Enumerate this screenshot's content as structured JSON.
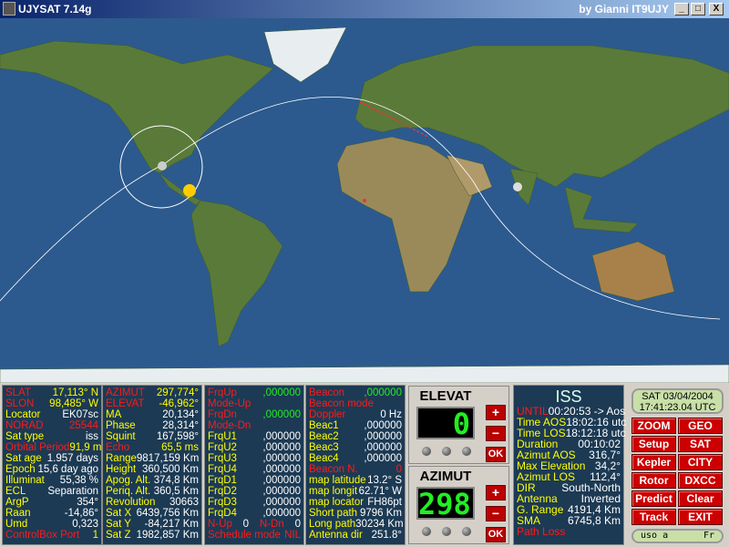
{
  "window": {
    "title": "UJYSAT 7.14g",
    "author": "by Gianni IT9UJY",
    "min": "_",
    "max": "□",
    "close": "X"
  },
  "col1": [
    {
      "label": "SLAT",
      "value": "17,113° N",
      "lc": "r",
      "vc": "y"
    },
    {
      "label": "SLON",
      "value": "98,485° W",
      "lc": "r",
      "vc": "y"
    },
    {
      "label": "Locator",
      "value": "EK07sc",
      "lc": "y",
      "vc": "w"
    },
    {
      "label": "NORAD",
      "value": "25544",
      "lc": "r",
      "vc": "r"
    },
    {
      "label": "Sat type",
      "value": "iss",
      "lc": "y",
      "vc": "w"
    },
    {
      "label": "Orbital Period",
      "value": "91,9 m",
      "lc": "r",
      "vc": "y"
    },
    {
      "label": "Sat age",
      "value": "1.957 days",
      "lc": "y",
      "vc": "w"
    },
    {
      "label": "Epoch",
      "value": "15,6 day ago",
      "lc": "y",
      "vc": "w"
    },
    {
      "label": "Illuminat",
      "value": "55,38 %",
      "lc": "y",
      "vc": "w"
    },
    {
      "label": "ECL",
      "value": "Separation",
      "lc": "y",
      "vc": "w"
    },
    {
      "label": "ArgP",
      "value": "354°",
      "lc": "y",
      "vc": "w"
    },
    {
      "label": "Raan",
      "value": "-14,86°",
      "lc": "y",
      "vc": "w"
    },
    {
      "label": "Umd",
      "value": "0,323",
      "lc": "y",
      "vc": "w"
    },
    {
      "label": "ControlBox Port",
      "value": "1",
      "lc": "r",
      "vc": "y"
    }
  ],
  "col2": [
    {
      "label": "AZIMUT",
      "value": "297,774°",
      "lc": "r",
      "vc": "y"
    },
    {
      "label": "ELEVAT",
      "value": "-46,962°",
      "lc": "r",
      "vc": "y"
    },
    {
      "label": "MA",
      "value": "20,134°",
      "lc": "y",
      "vc": "w"
    },
    {
      "label": "Phase",
      "value": "28,314°",
      "lc": "y",
      "vc": "w"
    },
    {
      "label": "Squint",
      "value": "167,598°",
      "lc": "y",
      "vc": "w"
    },
    {
      "label": "Echo",
      "value": "65,5 ms",
      "lc": "r",
      "vc": "y"
    },
    {
      "label": "Range",
      "value": "9817,159 Km",
      "lc": "y",
      "vc": "w"
    },
    {
      "label": "Height",
      "value": "360,500 Km",
      "lc": "y",
      "vc": "w"
    },
    {
      "label": "Apog. Alt.",
      "value": "374,8 Km",
      "lc": "y",
      "vc": "w"
    },
    {
      "label": "Periq. Alt.",
      "value": "360,5 Km",
      "lc": "y",
      "vc": "w"
    },
    {
      "label": "Revolution",
      "value": "30663",
      "lc": "y",
      "vc": "w"
    },
    {
      "label": "Sat X",
      "value": "6439,756 Km",
      "lc": "y",
      "vc": "w"
    },
    {
      "label": "Sat Y",
      "value": "-84,217 Km",
      "lc": "y",
      "vc": "w"
    },
    {
      "label": "Sat Z",
      "value": "1982,857 Km",
      "lc": "y",
      "vc": "w"
    }
  ],
  "col3": [
    {
      "label": "FrqUp",
      "value": ",000000",
      "lc": "r",
      "vc": "g"
    },
    {
      "label": "Mode-Up",
      "value": "",
      "lc": "r",
      "vc": "w"
    },
    {
      "label": "FrqDn",
      "value": ",000000",
      "lc": "r",
      "vc": "g"
    },
    {
      "label": "Mode-Dn",
      "value": "",
      "lc": "r",
      "vc": "w"
    },
    {
      "label": "FrqU1",
      "value": ",000000",
      "lc": "y",
      "vc": "w"
    },
    {
      "label": "FrqU2",
      "value": ",000000",
      "lc": "y",
      "vc": "w"
    },
    {
      "label": "FrqU3",
      "value": ",000000",
      "lc": "y",
      "vc": "w"
    },
    {
      "label": "FrqU4",
      "value": ",000000",
      "lc": "y",
      "vc": "w"
    },
    {
      "label": "FrqD1",
      "value": ",000000",
      "lc": "y",
      "vc": "w"
    },
    {
      "label": "FrqD2",
      "value": ",000000",
      "lc": "y",
      "vc": "w"
    },
    {
      "label": "FrqD3",
      "value": ",000000",
      "lc": "y",
      "vc": "w"
    },
    {
      "label": "FrqD4",
      "value": ",000000",
      "lc": "y",
      "vc": "w"
    }
  ],
  "col3_nup": {
    "label": "N-Up",
    "value": "0",
    "label2": "N-Dn",
    "value2": "0"
  },
  "col3_sched": {
    "label": "Schedule mode",
    "value": "NIL"
  },
  "col4": [
    {
      "label": "Beacon",
      "value": ",000000",
      "lc": "r",
      "vc": "g"
    },
    {
      "label": "Beacon mode",
      "value": "",
      "lc": "r",
      "vc": "w"
    },
    {
      "label": "Doppler",
      "value": "0 Hz",
      "lc": "r",
      "vc": "w"
    },
    {
      "label": "Beac1",
      "value": ",000000",
      "lc": "y",
      "vc": "w"
    },
    {
      "label": "Beac2",
      "value": ",000000",
      "lc": "y",
      "vc": "w"
    },
    {
      "label": "Beac3",
      "value": ",000000",
      "lc": "y",
      "vc": "w"
    },
    {
      "label": "Beac4",
      "value": ",000000",
      "lc": "y",
      "vc": "w"
    },
    {
      "label": "Beacon N.",
      "value": "0",
      "lc": "r",
      "vc": "r"
    },
    {
      "label": "map latitude",
      "value": "13.2° S",
      "lc": "y",
      "vc": "w"
    },
    {
      "label": "map longit",
      "value": "62.71° W",
      "lc": "y",
      "vc": "w"
    },
    {
      "label": "map locator",
      "value": "FH86pt",
      "lc": "y",
      "vc": "w"
    },
    {
      "label": "Short path",
      "value": "9796 Km",
      "lc": "y",
      "vc": "w"
    },
    {
      "label": "Long path",
      "value": "30234 Km",
      "lc": "y",
      "vc": "w"
    },
    {
      "label": "Antenna dir",
      "value": "251.8°",
      "lc": "y",
      "vc": "w"
    }
  ],
  "elevat": {
    "title": "ELEVAT",
    "display": "0",
    "plus": "+",
    "minus": "−",
    "ok": "OK"
  },
  "azimut": {
    "title": "AZIMUT",
    "display": "298",
    "plus": "+",
    "minus": "−",
    "ok": "OK"
  },
  "iss": {
    "name": "ISS",
    "rows": [
      {
        "label": "UNTIL",
        "value": "00:20:53 -> Aos",
        "lc": "r",
        "vc": "w"
      },
      {
        "label": "Time AOS",
        "value": "18:02:16 utc",
        "lc": "y",
        "vc": "w"
      },
      {
        "label": "Time LOS",
        "value": "18:12:18 utc",
        "lc": "y",
        "vc": "w"
      },
      {
        "label": "Duration",
        "value": "00:10:02",
        "lc": "y",
        "vc": "w"
      },
      {
        "label": "Azimut AOS",
        "value": "316,7°",
        "lc": "y",
        "vc": "w"
      },
      {
        "label": "Max Elevation",
        "value": "34,2°",
        "lc": "y",
        "vc": "w"
      },
      {
        "label": "Azimut LOS",
        "value": "112,4°",
        "lc": "y",
        "vc": "w"
      },
      {
        "label": "DIR",
        "value": "South-North",
        "lc": "y",
        "vc": "w"
      },
      {
        "label": "Antenna",
        "value": "Inverted",
        "lc": "y",
        "vc": "w"
      },
      {
        "label": "G. Range",
        "value": "4191,4 Km",
        "lc": "y",
        "vc": "w"
      },
      {
        "label": "SMA",
        "value": "6745,8 Km",
        "lc": "y",
        "vc": "w"
      },
      {
        "label": "Path Loss",
        "value": "",
        "lc": "r",
        "vc": "w"
      }
    ]
  },
  "clock": {
    "date": "SAT 03/04/2004",
    "time": "17:41:23.04 UTC"
  },
  "buttons": [
    "ZOOM",
    "GEO",
    "Setup",
    "SAT",
    "Kepler",
    "CITY",
    "Rotor",
    "DXCC",
    "Predict",
    "Clear",
    "Track",
    "EXIT"
  ],
  "status": {
    "left": "uso a",
    "right": "Fr"
  },
  "colors": {
    "label_red": "#ff1a1a",
    "label_yellow": "#ffff00",
    "panel_bg": "#1c3a54",
    "lcd_green": "#22ee22"
  }
}
